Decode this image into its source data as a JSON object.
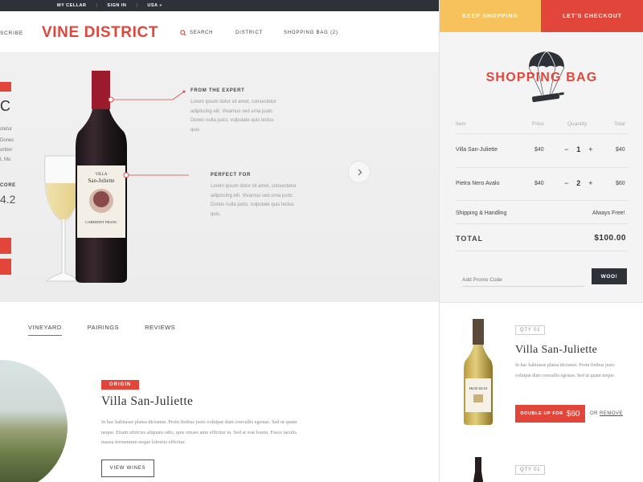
{
  "topbar": {
    "my_cellar": "MY CELLAR",
    "sign_in": "SIGN IN",
    "country": "USA »"
  },
  "nav": {
    "subscribe_fragment": "SCRIBE",
    "brand": "VINE DISTRICT",
    "search": "SEARCH",
    "district": "DISTRICT",
    "shopping_bag": "SHOPPING BAG (2)"
  },
  "hero": {
    "big_letter": "C",
    "score_label": "CORE",
    "score_value": "4.2",
    "text_fragments": [
      "ctetur",
      "Donec",
      "ortitor",
      "t, Mu"
    ],
    "callouts": [
      {
        "title": "FROM THE EXPERT",
        "body": "Lorem ipsum dolor sit amet, consectetur adipiscing elit. Vivamus sed urna justo. Donec nulla justo, vulputate quis lectus quis."
      },
      {
        "title": "PERFECT FOR",
        "body": "Lorem ipsum dolor sit amet, consectetur adipiscing elit. Vivamus sed urna justo. Donec nulla justo, vulputate quis lectus quis."
      }
    ]
  },
  "tabs": [
    {
      "label": "VINEYARD",
      "active": true
    },
    {
      "label": "PAIRINGS",
      "active": false
    },
    {
      "label": "REVIEWS",
      "active": false
    }
  ],
  "origin": {
    "badge": "ORIGIN",
    "title": "Villa San-Juliette",
    "text": "In hac habitasse platea dictumst. Proin finibus justo volutpat dum convallis egestas. Sed ut quam neque. Etiam ultricies aliquam odio, quis ornare ante efficitur in. Sed at erat lorem. Fusce iaculis massa fermentum neque lobortis efficitur.",
    "view_button": "VIEW WINES"
  },
  "panel": {
    "keep_shopping": "KEEP SHOPPING",
    "checkout": "LET'S CHECKOUT",
    "title": "SHOPPING BAG",
    "headers": {
      "item": "Item",
      "price": "Price",
      "quantity": "Quantity",
      "total": "Total"
    },
    "items": [
      {
        "name": "Villa San-Juliette",
        "price": "$40",
        "qty": "1",
        "total": "$40"
      },
      {
        "name": "Pietra Nero Avalo",
        "price": "$40",
        "qty": "2",
        "total": "$60"
      }
    ],
    "shipping_label": "Shipping & Handling",
    "shipping_value": "Always Free!",
    "total_label": "TOTAL",
    "total_value": "$100.00",
    "promo_placeholder": "Add Promo Code",
    "promo_button": "WOO!",
    "minus": "−",
    "plus": "+"
  },
  "upsell": {
    "qty_badge": "QTY 01",
    "title": "Villa San-Juliette",
    "text": "In hac habitasse platea dictumst. Proin finibus justo volutpat dum convallis egestas. Sed ut quam neque.",
    "double_label": "DOUBLE UP FOR",
    "double_price": "$60",
    "or": "OR",
    "remove": "REMOVE",
    "qty_badge_2": "QTY 01"
  },
  "colors": {
    "accent": "#e2463a",
    "yellow": "#f7c15c",
    "dark": "#2e3138"
  }
}
